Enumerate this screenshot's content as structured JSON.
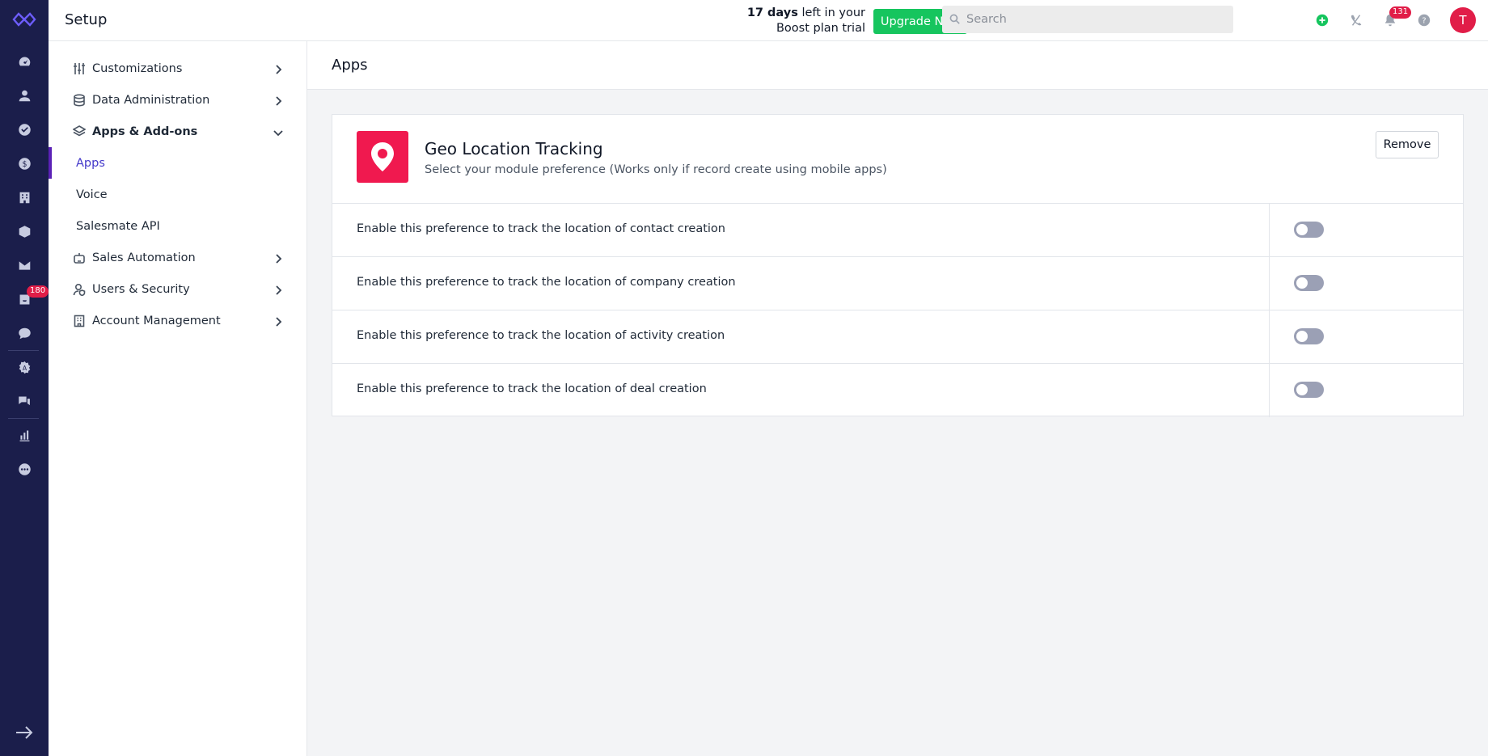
{
  "header": {
    "title": "Setup",
    "trial_days": "17 days",
    "trial_text_1": " left in your",
    "trial_text_2": "Boost plan trial",
    "upgrade_label": "Upgrade Now",
    "search_placeholder": "Search",
    "notification_count": "131",
    "avatar_initial": "T"
  },
  "rail": {
    "inbox_badge": "180",
    "icons": [
      "dashboard-icon",
      "contacts-icon",
      "tasks-icon",
      "deals-icon",
      "companies-icon",
      "products-icon",
      "email-icon",
      "inbox-icon",
      "chat-icon",
      "automation-icon",
      "messages-icon",
      "reports-icon",
      "more-icon"
    ]
  },
  "sidebar": {
    "items": [
      {
        "label": "Customizations",
        "icon": "sliders-icon"
      },
      {
        "label": "Data Administration",
        "icon": "database-icon"
      },
      {
        "label": "Apps & Add-ons",
        "icon": "layers-icon"
      },
      {
        "label": "Sales Automation",
        "icon": "robot-icon"
      },
      {
        "label": "Users & Security",
        "icon": "user-shield-icon"
      },
      {
        "label": "Account Management",
        "icon": "building-icon"
      }
    ],
    "sub_items": [
      {
        "label": "Apps"
      },
      {
        "label": "Voice"
      },
      {
        "label": "Salesmate API"
      }
    ]
  },
  "main": {
    "page_title": "Apps",
    "app": {
      "name": "Geo Location Tracking",
      "description": "Select your module preference (Works only if record create using mobile apps)",
      "remove_label": "Remove"
    },
    "preferences": [
      {
        "label": "Enable this preference to track the location of contact creation",
        "enabled": false
      },
      {
        "label": "Enable this preference to track the location of company creation",
        "enabled": false
      },
      {
        "label": "Enable this preference to track the location of activity creation",
        "enabled": false
      },
      {
        "label": "Enable this preference to track the location of deal creation",
        "enabled": false
      }
    ]
  },
  "colors": {
    "rail_bg": "#1b1e4b",
    "accent": "#5b21b6",
    "upgrade": "#16c55e",
    "brand_red": "#f0194f"
  }
}
